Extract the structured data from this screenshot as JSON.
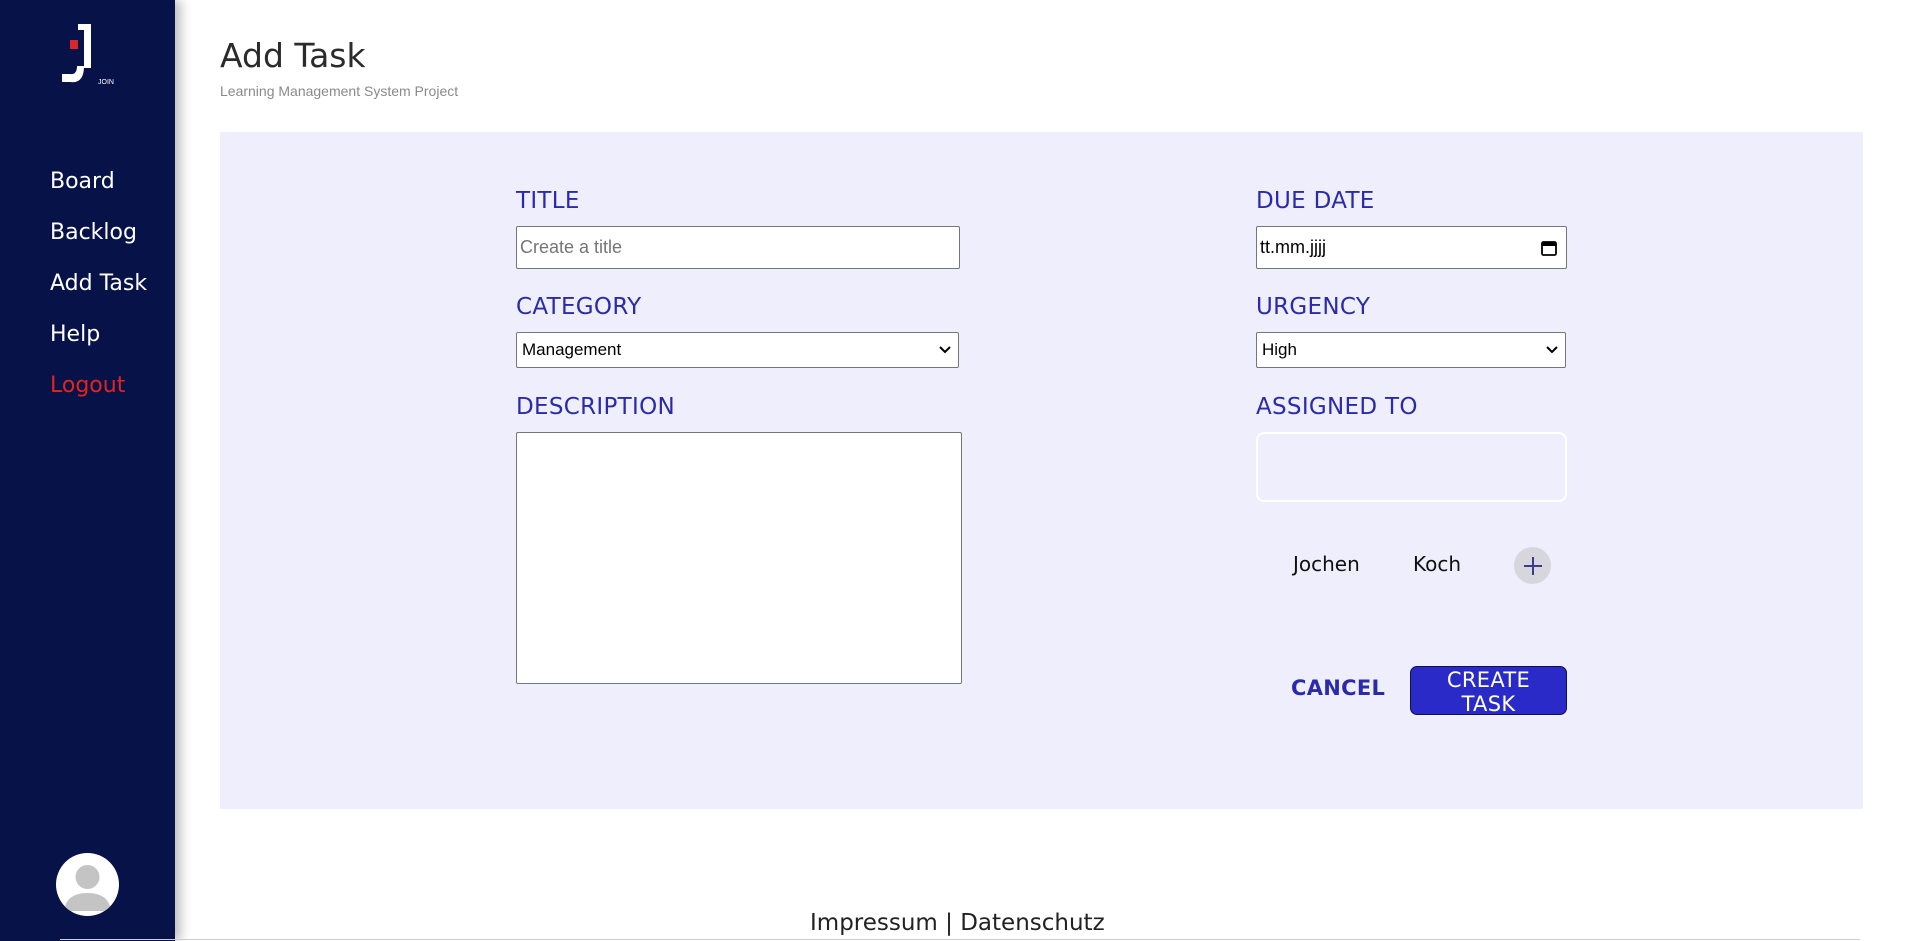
{
  "sidebar": {
    "logo_text": "JOIN",
    "items": [
      {
        "label": "Board"
      },
      {
        "label": "Backlog"
      },
      {
        "label": "Add Task"
      },
      {
        "label": "Help"
      },
      {
        "label": "Logout"
      }
    ]
  },
  "header": {
    "title": "Add Task",
    "subtitle": "Learning Management System Project"
  },
  "form": {
    "title": {
      "label": "TITLE",
      "value": "",
      "placeholder": "Create a title"
    },
    "category": {
      "label": "CATEGORY",
      "value": "Management"
    },
    "description": {
      "label": "DESCRIPTION",
      "value": ""
    },
    "due_date": {
      "label": "DUE DATE",
      "value": "tt.mm.jjjj"
    },
    "urgency": {
      "label": "URGENCY",
      "value": "High"
    },
    "assigned_to": {
      "label": "ASSIGNED TO",
      "members": [
        {
          "name": "Jochen"
        },
        {
          "name": "Koch"
        }
      ]
    },
    "cancel_label": "CANCEL",
    "create_label": "CREATE TASK"
  },
  "footer": {
    "impressum": "Impressum",
    "separator": "|",
    "datenschutz": "Datenschutz"
  },
  "colors": {
    "sidebar_bg": "#061248",
    "accent": "#2a2aab",
    "button_bg": "#2a2ac8",
    "panel_bg": "#eeeefc",
    "logout": "#e3241d"
  },
  "icons": [
    "join-logo-icon",
    "user-avatar-icon",
    "calendar-icon",
    "chevron-down-icon",
    "plus-icon"
  ]
}
